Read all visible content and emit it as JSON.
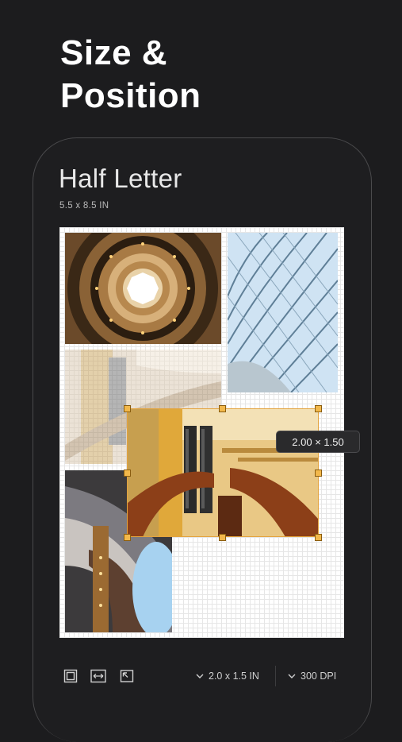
{
  "headline": {
    "line1": "Size &",
    "line2": "Position"
  },
  "document": {
    "title": "Half Letter",
    "size_label": "5.5 x 8.5 IN"
  },
  "selection": {
    "dimensions_label": "2.00 × 1.50"
  },
  "toolbar": {
    "icons": [
      "fit-frame-icon",
      "stretch-width-icon",
      "align-corner-icon"
    ],
    "size_dropdown": "2.0 x 1.5 IN",
    "dpi_dropdown": "300 DPI"
  },
  "colors": {
    "background": "#1c1c1e",
    "accent": "#f2b84b",
    "canvas": "#ffffff"
  }
}
